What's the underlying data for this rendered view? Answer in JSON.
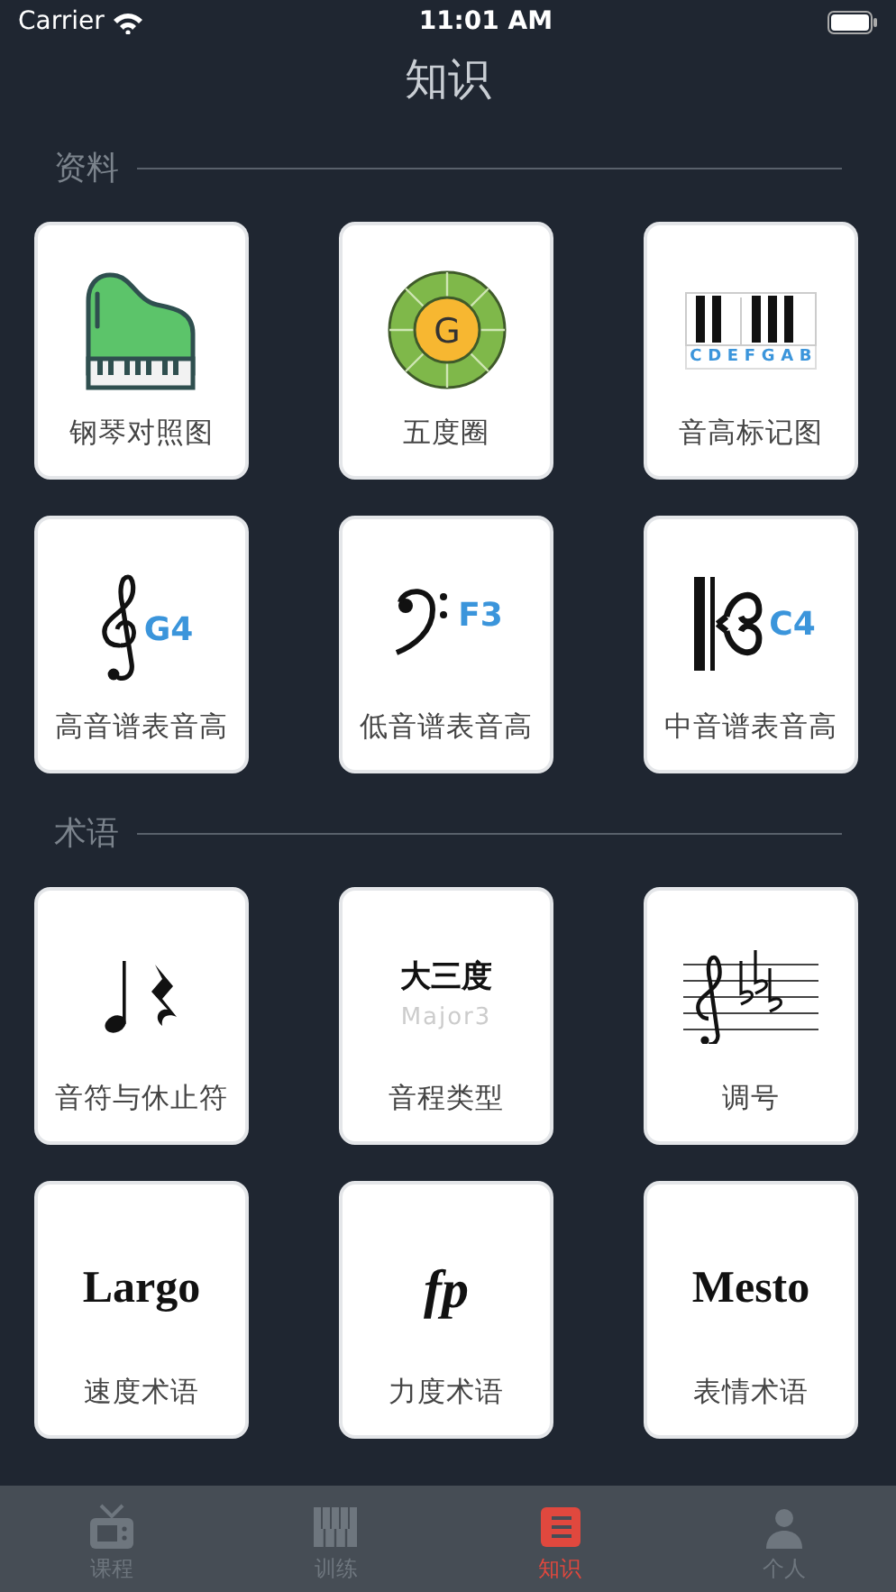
{
  "status_bar": {
    "carrier": "Carrier",
    "time": "11:01 AM"
  },
  "title": "知识",
  "sections": [
    {
      "heading": "资料",
      "cards": [
        {
          "kind": "piano",
          "label": "钢琴对照图"
        },
        {
          "kind": "circle",
          "center": "G",
          "label": "五度圈"
        },
        {
          "kind": "keyboard",
          "keys": [
            "C",
            "D",
            "E",
            "F",
            "G",
            "A",
            "B"
          ],
          "label": "音高标记图"
        },
        {
          "kind": "treble_clef",
          "note": "G4",
          "label": "高音谱表音高"
        },
        {
          "kind": "bass_clef",
          "note": "F3",
          "label": "低音谱表音高"
        },
        {
          "kind": "alto_clef",
          "note": "C4",
          "label": "中音谱表音高"
        }
      ]
    },
    {
      "heading": "术语",
      "cards": [
        {
          "kind": "notes",
          "label": "音符与休止符"
        },
        {
          "kind": "interval",
          "name": "大三度",
          "subtitle": "Major3",
          "label": "音程类型"
        },
        {
          "kind": "key_signature",
          "label": "调号"
        },
        {
          "kind": "term",
          "term": "Largo",
          "italic": false,
          "label": "速度术语"
        },
        {
          "kind": "term",
          "term": "fp",
          "italic": true,
          "label": "力度术语"
        },
        {
          "kind": "term",
          "term": "Mesto",
          "italic": false,
          "label": "表情术语"
        }
      ]
    }
  ],
  "tabs": [
    {
      "kind": "tv",
      "label": "课程",
      "selected": false
    },
    {
      "kind": "keys",
      "label": "训练",
      "selected": false
    },
    {
      "kind": "book",
      "label": "知识",
      "selected": true
    },
    {
      "kind": "person",
      "label": "个人",
      "selected": false
    }
  ]
}
